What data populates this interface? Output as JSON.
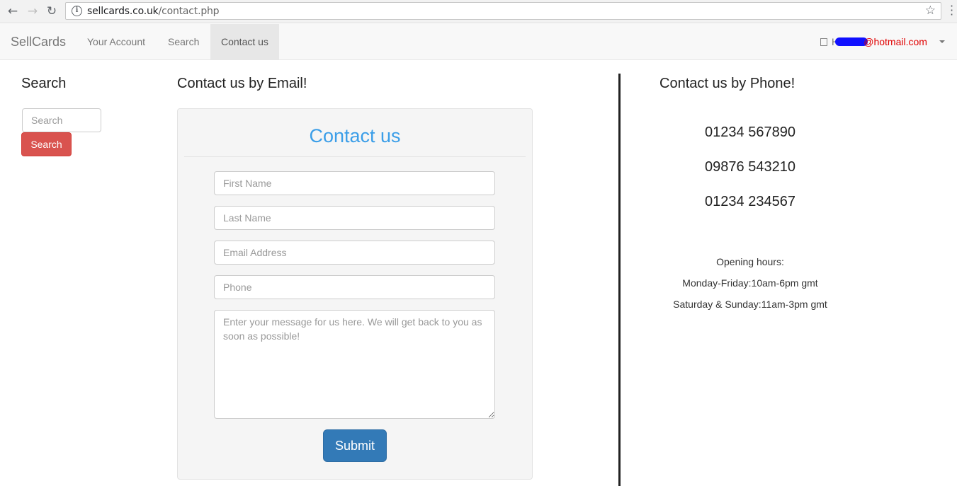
{
  "browser": {
    "url_domain": "sellcards.co.uk",
    "url_path": "/contact.php",
    "back_icon": "arrow-left",
    "forward_icon": "arrow-right",
    "reload_icon": "reload",
    "info_icon": "i",
    "star_icon": "☆"
  },
  "navbar": {
    "brand": "SellCards",
    "links": [
      "Your Account",
      "Search",
      "Contact us"
    ],
    "active_link": "Contact us",
    "user_prefix": "Hi",
    "user_email_suffix": "@hotmail.com"
  },
  "sidebar": {
    "heading": "Search",
    "search_placeholder": "Search",
    "search_button": "Search"
  },
  "email_section": {
    "heading": "Contact us by Email!",
    "form_title": "Contact us",
    "first_name_placeholder": "First Name",
    "last_name_placeholder": "Last Name",
    "email_placeholder": "Email Address",
    "phone_placeholder": "Phone",
    "message_placeholder": "Enter your message for us here. We will get back to you as soon as possible!",
    "submit_label": "Submit"
  },
  "phone_section": {
    "heading": "Contact us by Phone!",
    "numbers": [
      "01234 567890",
      "09876 543210",
      "01234 234567"
    ],
    "hours_title": "Opening hours:",
    "hours_weekday": "Monday-Friday:10am-6pm gmt",
    "hours_weekend": "Saturday & Sunday:11am-3pm gmt"
  },
  "colors": {
    "accent_blue": "#3b9ee8",
    "search_button": "#d9534f",
    "submit_button": "#337ab7",
    "email_red": "#e00000"
  }
}
